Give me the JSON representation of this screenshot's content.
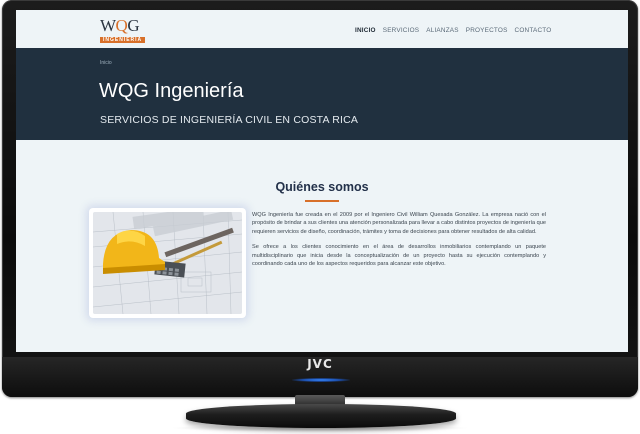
{
  "tv": {
    "brand": "JVC"
  },
  "site": {
    "logo": {
      "text_w": "W",
      "text_q": "Q",
      "text_g": "G",
      "subtitle": "INGENIERIA"
    },
    "nav": {
      "items": [
        {
          "label": "INICIO",
          "active": true
        },
        {
          "label": "SERVICIOS",
          "active": false
        },
        {
          "label": "ALIANZAS",
          "active": false
        },
        {
          "label": "PROYECTOS",
          "active": false
        },
        {
          "label": "CONTACTO",
          "active": false
        }
      ]
    },
    "hero": {
      "breadcrumb": "Inicio",
      "title": "WQG Ingeniería",
      "subtitle": "SERVICIOS DE INGENIERÍA CIVIL EN COSTA RICA"
    },
    "about": {
      "title": "Quiénes somos",
      "paragraph_1": "WQG Ingeniería fue creada en el 2009 por el Ingeniero Civil William Quesada González. La empresa nació con el propósito de brindar a sus clientes una atención personalizada para llevar a cabo distintos proyectos de ingeniería que requieren servicios de diseño, coordinación, trámites y toma de decisiones para obtener resultados de alta calidad.",
      "paragraph_2": "Se ofrece a los clientes conocimiento en el área de desarrollos inmobiliarios contemplando un paquete multidisciplinario que inicia desde la conceptualización de un proyecto hasta su ejecución contemplando y coordinando cada uno de los aspectos requeridos para alcanzar este objetivo."
    }
  },
  "colors": {
    "accent": "#d8702a",
    "hero_bg": "#20303f",
    "page_bg": "#eef4f7",
    "heading": "#23314a",
    "tv_led": "#3a8bff"
  }
}
